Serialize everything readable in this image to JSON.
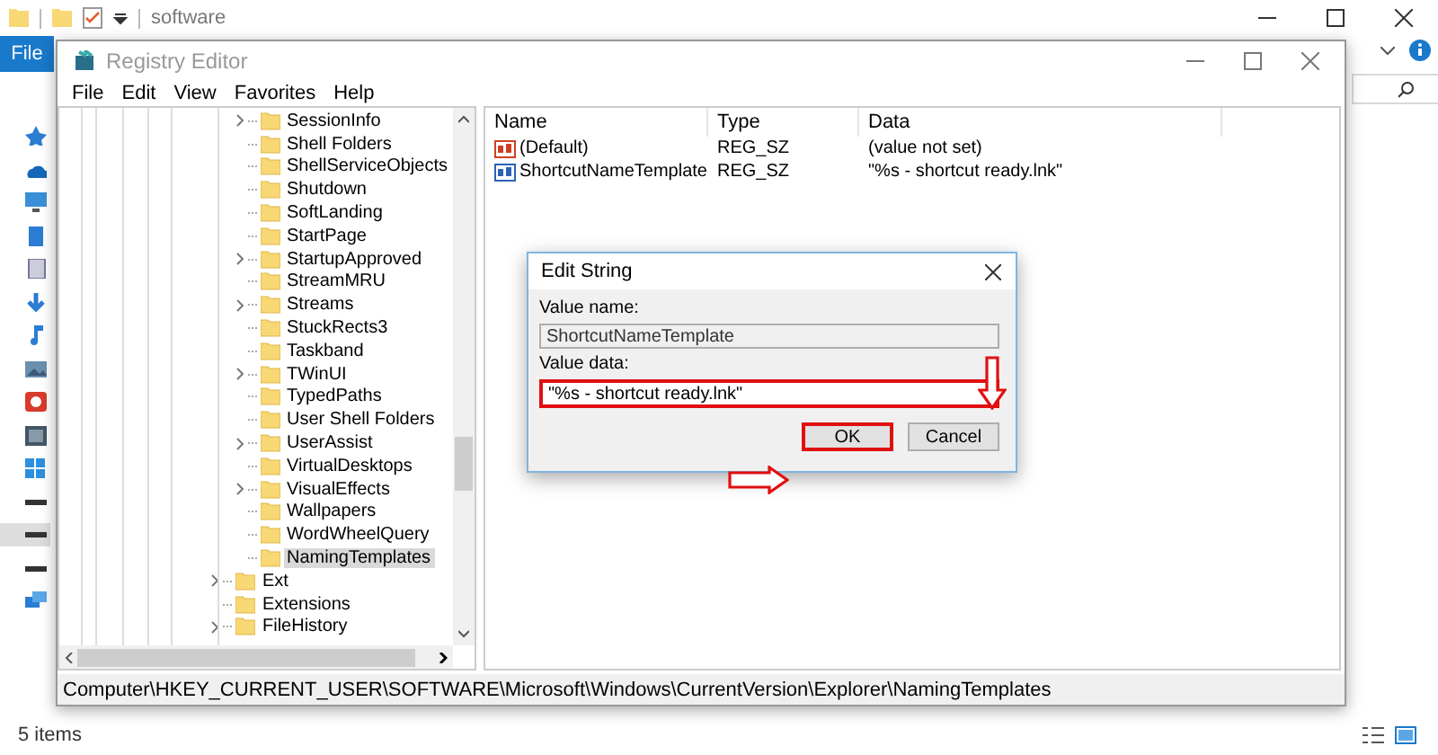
{
  "explorer": {
    "title": "software",
    "file_tab": "File",
    "status": "5 items"
  },
  "regedit": {
    "title": "Registry Editor",
    "menu": [
      "File",
      "Edit",
      "View",
      "Favorites",
      "Help"
    ],
    "tree": [
      {
        "children": [
          {
            "label": "SessionInfo",
            "expandable": true,
            "selected": false
          },
          {
            "label": "Shell Folders",
            "expandable": false,
            "selected": false
          },
          {
            "label": "ShellServiceObjects",
            "expandable": false,
            "selected": false
          },
          {
            "label": "Shutdown",
            "expandable": false,
            "selected": false
          },
          {
            "label": "SoftLanding",
            "expandable": false,
            "selected": false
          },
          {
            "label": "StartPage",
            "expandable": false,
            "selected": false
          },
          {
            "label": "StartupApproved",
            "expandable": true,
            "selected": false
          },
          {
            "label": "StreamMRU",
            "expandable": false,
            "selected": false
          },
          {
            "label": "Streams",
            "expandable": true,
            "selected": false
          },
          {
            "label": "StuckRects3",
            "expandable": false,
            "selected": false
          },
          {
            "label": "Taskband",
            "expandable": false,
            "selected": false
          },
          {
            "label": "TWinUI",
            "expandable": true,
            "selected": false
          },
          {
            "label": "TypedPaths",
            "expandable": false,
            "selected": false
          },
          {
            "label": "User Shell Folders",
            "expandable": false,
            "selected": false
          },
          {
            "label": "UserAssist",
            "expandable": true,
            "selected": false
          },
          {
            "label": "VirtualDesktops",
            "expandable": false,
            "selected": false
          },
          {
            "label": "VisualEffects",
            "expandable": true,
            "selected": false
          },
          {
            "label": "Wallpapers",
            "expandable": false,
            "selected": false
          },
          {
            "label": "WordWheelQuery",
            "expandable": false,
            "selected": false
          },
          {
            "label": "NamingTemplates",
            "expandable": false,
            "selected": true
          }
        ]
      },
      {
        "label": "Ext",
        "expandable": true,
        "selected": false
      },
      {
        "label": "Extensions",
        "expandable": false,
        "selected": false
      },
      {
        "label": "FileHistory",
        "expandable": true,
        "selected": false
      }
    ],
    "columns": [
      "Name",
      "Type",
      "Data"
    ],
    "values": [
      {
        "name": "(Default)",
        "type": "REG_SZ",
        "data": "(value not set)",
        "kind": "default"
      },
      {
        "name": "ShortcutNameTemplate",
        "type": "REG_SZ",
        "data": "\"%s - shortcut ready.lnk\"",
        "kind": "custom"
      }
    ],
    "path": "Computer\\HKEY_CURRENT_USER\\SOFTWARE\\Microsoft\\Windows\\CurrentVersion\\Explorer\\NamingTemplates"
  },
  "dialog": {
    "title": "Edit String",
    "name_label": "Value name:",
    "name_value": "ShortcutNameTemplate",
    "data_label": "Value data:",
    "data_value": "\"%s - shortcut ready.lnk\"",
    "data_highlighted": true,
    "buttons": [
      {
        "label": "OK",
        "highlighted": true
      },
      {
        "label": "Cancel",
        "highlighted": false
      }
    ]
  }
}
